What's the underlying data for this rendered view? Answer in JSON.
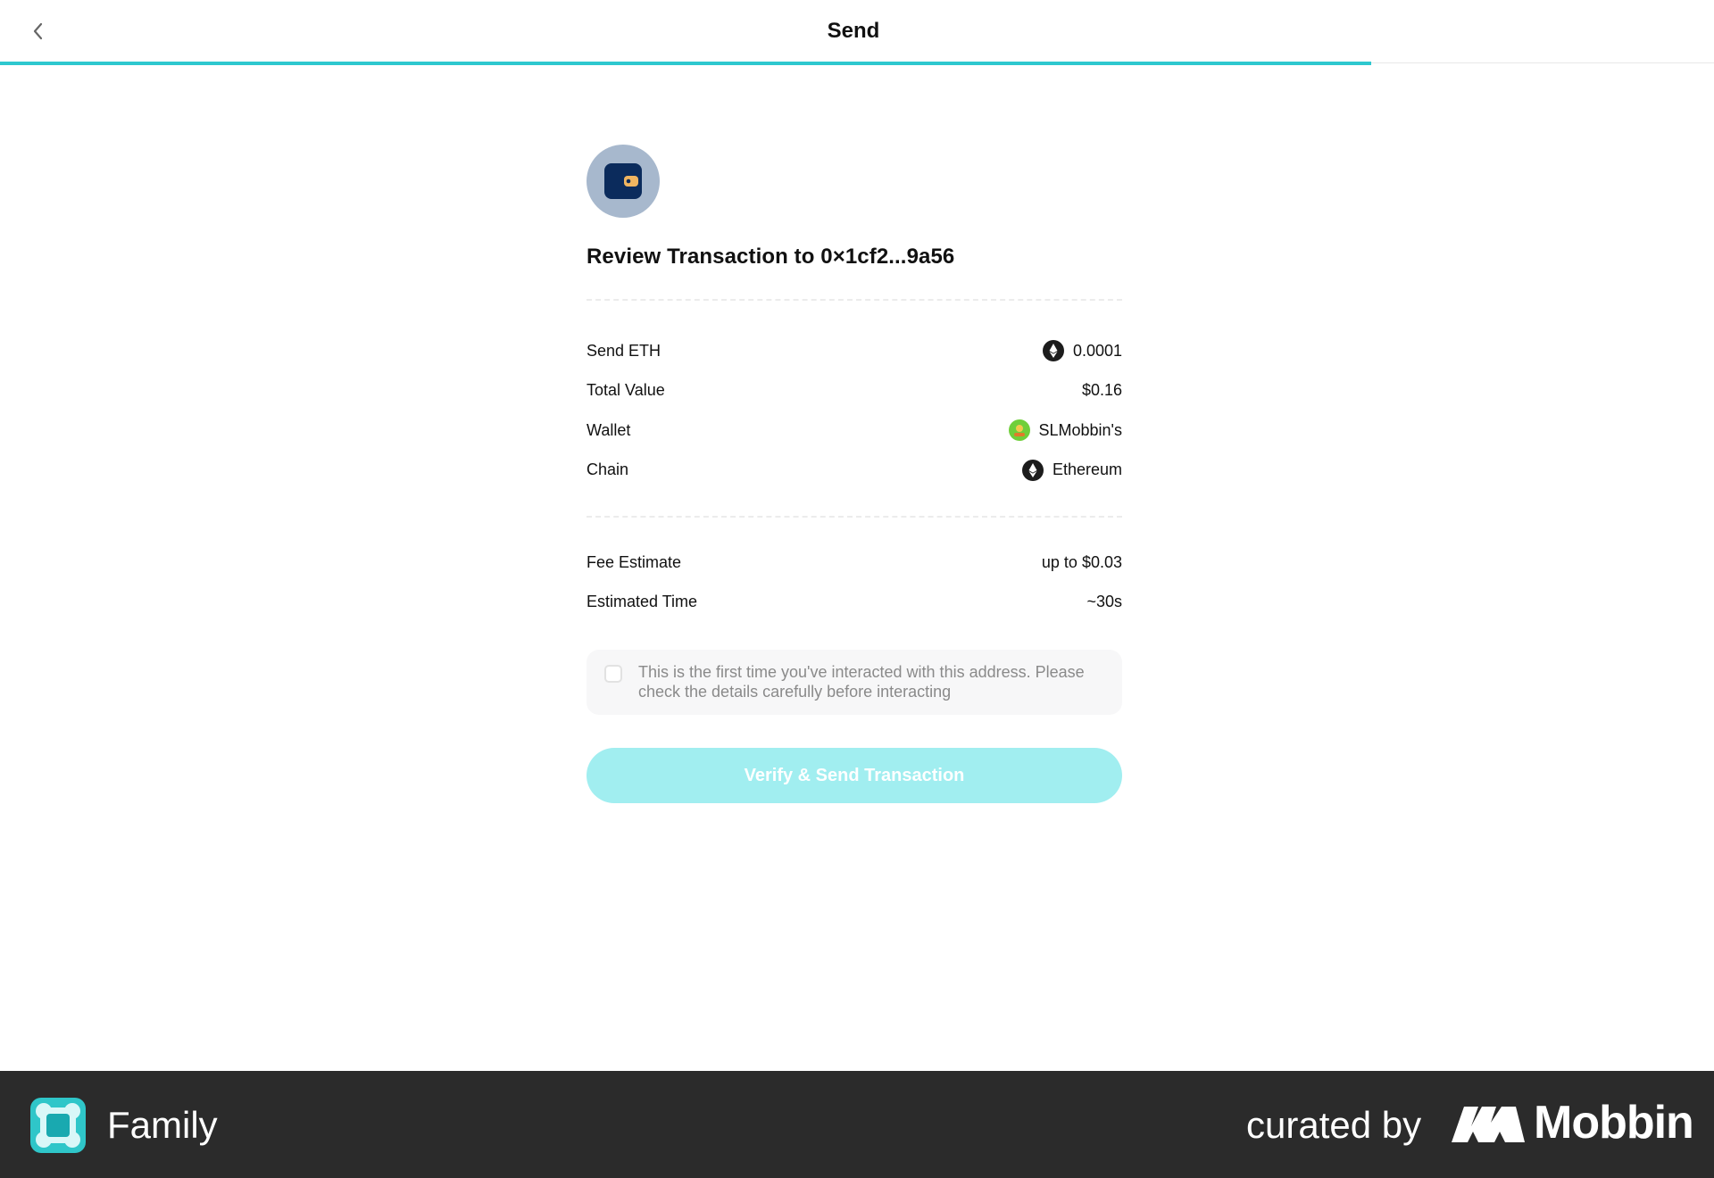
{
  "header": {
    "title": "Send",
    "back_icon": "chevron-left-icon",
    "progress_percent": 80,
    "progress_color": "#2ec8cf"
  },
  "review": {
    "avatar_icon": "wallet-icon",
    "title": "Review Transaction to 0×1cf2...9a56"
  },
  "details": [
    {
      "label": "Send ETH",
      "value": "0.0001",
      "icon": "ethereum-icon"
    },
    {
      "label": "Total Value",
      "value": "$0.16"
    },
    {
      "label": "Wallet",
      "value": "SLMobbin's",
      "icon": "wallet-avatar-icon"
    },
    {
      "label": "Chain",
      "value": "Ethereum",
      "icon": "ethereum-icon"
    }
  ],
  "fees": [
    {
      "label": "Fee Estimate",
      "value": "up to $0.03"
    },
    {
      "label": "Estimated Time",
      "value": "~30s"
    }
  ],
  "warning": {
    "checked": false,
    "text": "This is the first time you've interacted with this address. Please check the details carefully before interacting"
  },
  "cta": {
    "label": "Verify & Send Transaction",
    "enabled": false,
    "color": "#a1eef0"
  },
  "footer": {
    "app_name": "Family",
    "curated_by": "curated by",
    "brand": "Mobbin"
  }
}
